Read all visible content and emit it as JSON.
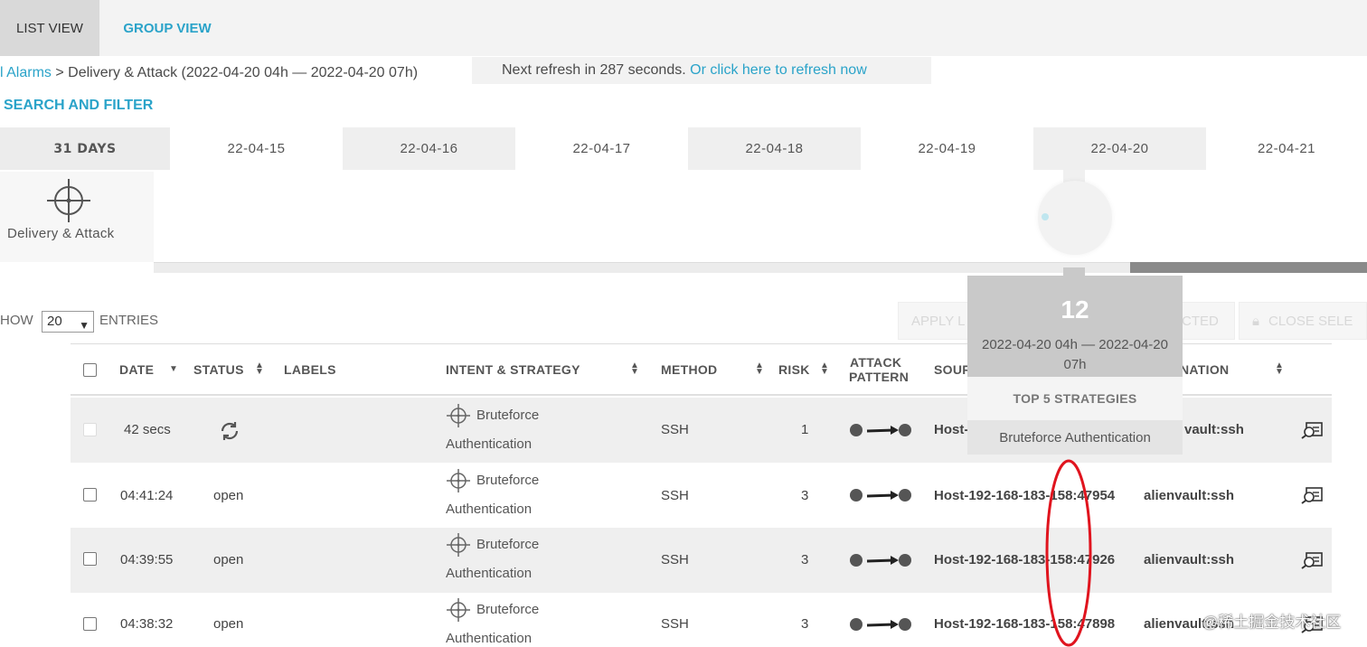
{
  "tabs": {
    "list_view": "LIST VIEW",
    "group_view": "GROUP VIEW"
  },
  "breadcrumb": {
    "root": "l Alarms",
    "separator": ">",
    "current": "Delivery & Attack (2022-04-20 04h — 2022-04-20 07h)"
  },
  "refresh": {
    "text": "Next refresh in 287 seconds.",
    "link": "Or click here to refresh now"
  },
  "search_filter": "SEARCH AND FILTER",
  "date_strip": [
    "31 DAYS",
    "22-04-15",
    "22-04-16",
    "22-04-17",
    "22-04-18",
    "22-04-19",
    "22-04-20",
    "22-04-21"
  ],
  "category": {
    "label": "Delivery & Attack",
    "icon": "crosshair-icon"
  },
  "entries": {
    "show": "HOW",
    "value": "20",
    "suffix": "ENTRIES"
  },
  "actions": {
    "apply_label": "APPLY L",
    "selected": "CTED",
    "close_selected": "CLOSE SELE"
  },
  "table": {
    "headers": {
      "date": "DATE",
      "status": "STATUS",
      "labels": "LABELS",
      "intent": "INTENT & STRATEGY",
      "method": "METHOD",
      "risk": "RISK",
      "attack_pattern_1": "ATTACK",
      "attack_pattern_2": "PATTERN",
      "source": "SOUR",
      "destination": "NATION"
    },
    "rows": [
      {
        "date": "42 secs",
        "status": "",
        "strategy_1": "Bruteforce",
        "strategy_2": "Authentication",
        "method": "SSH",
        "risk": "1",
        "source": "Host-",
        "destination": "vault:ssh"
      },
      {
        "date": "04:41:24",
        "status": "open",
        "strategy_1": "Bruteforce",
        "strategy_2": "Authentication",
        "method": "SSH",
        "risk": "3",
        "source": "Host-192-168-183-158:47954",
        "destination": "alienvault:ssh"
      },
      {
        "date": "04:39:55",
        "status": "open",
        "strategy_1": "Bruteforce",
        "strategy_2": "Authentication",
        "method": "SSH",
        "risk": "3",
        "source": "Host-192-168-183-158:47926",
        "destination": "alienvault:ssh"
      },
      {
        "date": "04:38:32",
        "status": "open",
        "strategy_1": "Bruteforce",
        "strategy_2": "Authentication",
        "method": "SSH",
        "risk": "3",
        "source": "Host-192-168-183-158:47898",
        "destination": "alienvault:ssh"
      }
    ]
  },
  "popup": {
    "count": "12",
    "range": "2022-04-20 04h — 2022-04-20 07h",
    "heading": "TOP 5 STRATEGIES",
    "item": "Bruteforce Authentication"
  },
  "watermark": "@稀土掘金技术社区",
  "colors": {
    "accent": "#2aa3c9",
    "annotation": "#e0141e"
  }
}
